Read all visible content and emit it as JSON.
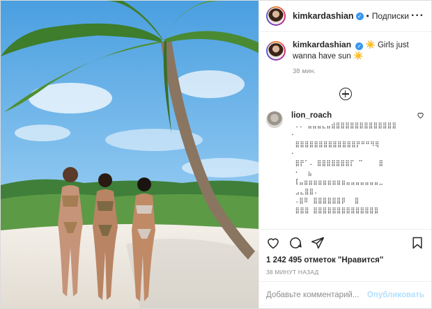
{
  "post": {
    "username": "kimkardashian",
    "verified_icon": "verified-badge-icon",
    "separator": "•",
    "follow_label": "Подписки",
    "more_label": "···",
    "caption": "☀️ Girls just wanna have sun ☀️",
    "time_ago": "38 мин.",
    "comment": {
      "username": "lion_roach",
      "art_lines": [
        " ..⠀⣤⣤⣤⣄⣤⣾⣿⣿⣿⣿⣿⣿⣿⣿⣿⣿⣿⣿⣿",
        "⠂",
        " ⣿⣿⣿⣿⣿⣿⣿⣿⣿⣿⣿⣿⣿⡟⠛⠛⠻⢿",
        "⠂",
        " ⣿⡟⠁. ⣿⣿⣿⣿⣿⣿⣿⡏ ⠉    ⣿",
        " ⠂  ⣦",
        " [⣤⣶⣶⣶⣶⣶⣶⣶⣶⣶⣤⣤⣤⣤⣤⣤⣤⣀",
        " ⣠⣄⣿⣿.",
        " .⣿⠿⠀⣿⣿⣿⣿⣿⣿⡿ ⠀⣿",
        " ⣿⣿⣿ ⣿⣿⣿⣿⣿⣿⣿⣿⣿⣿⣿⣿⣿⣿"
      ]
    },
    "likes": "1 242 495 отметок \"Нравится\"",
    "posted_ago": "38 МИНУТ НАЗАД",
    "add_comment_placeholder": "Добавьте комментарий...",
    "publish_label": "Опубликовать"
  },
  "icons": [
    "heart-icon",
    "comment-icon",
    "share-icon",
    "bookmark-icon",
    "add-icon",
    "small-heart-icon"
  ],
  "colors": {
    "accent": "#3897f0",
    "publish": "#b2dffc",
    "muted": "#8e8e8e"
  }
}
